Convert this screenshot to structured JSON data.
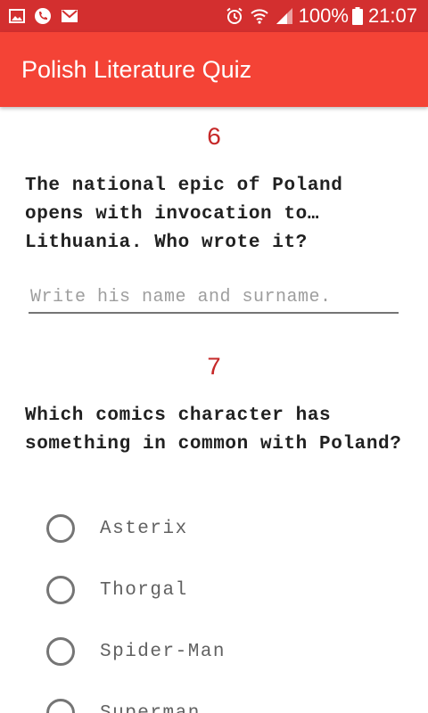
{
  "status_bar": {
    "left_icons": [
      "image-icon",
      "phone-icon",
      "gmail-icon"
    ],
    "right_icons": [
      "alarm-icon",
      "wifi-icon",
      "signal-icon"
    ],
    "battery": "100%",
    "time": "21:07"
  },
  "app_bar": {
    "title": "Polish Literature Quiz"
  },
  "questions": [
    {
      "number": "6",
      "text": "The national epic of Poland opens with invocation to… Lithuania. Who wrote it?",
      "input_placeholder": "Write his name and surname.",
      "input_value": ""
    },
    {
      "number": "7",
      "text": "Which comics character has something in common with Poland?",
      "options": [
        "Asterix",
        "Thorgal",
        "Spider-Man",
        "Superman"
      ]
    }
  ],
  "colors": {
    "status_bar": "#d32f2f",
    "app_bar": "#f44336",
    "question_number": "#c62828"
  }
}
